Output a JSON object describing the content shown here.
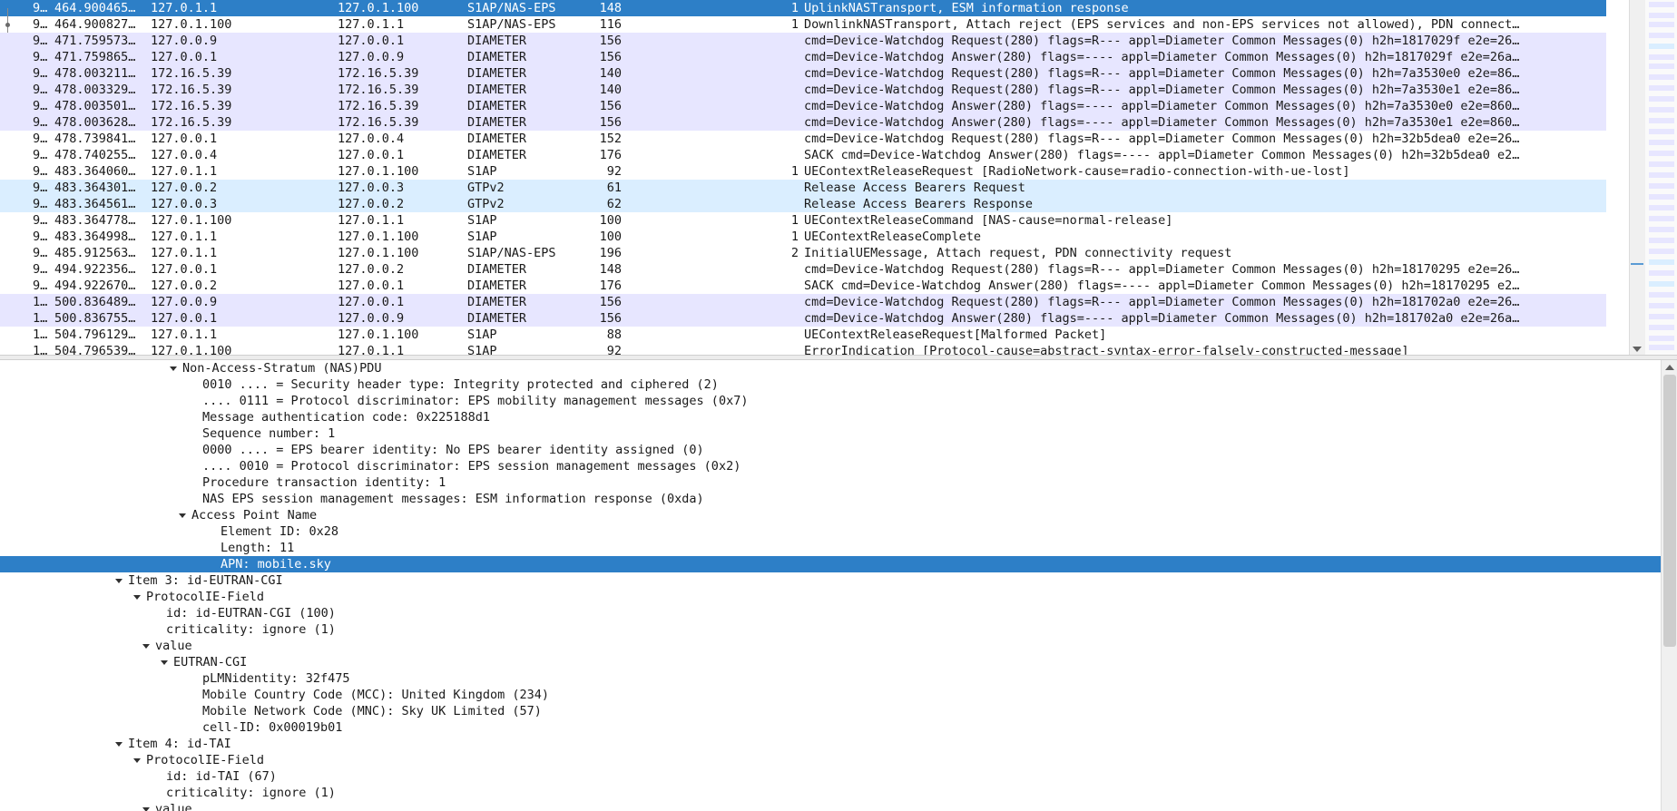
{
  "colors": {
    "selected": "#2d7fc7",
    "diameter_row": "#e7e6ff",
    "gtp_row": "#daeeff",
    "white_row": "#ffffff"
  },
  "packet_list": {
    "rows": [
      {
        "no": "9…",
        "time": "464.900465…",
        "src": "127.0.1.1",
        "dst": "127.0.1.100",
        "proto": "S1AP/NAS-EPS",
        "len": "148",
        "id": "1",
        "info": "UplinkNASTransport, ESM information response",
        "style": "sel"
      },
      {
        "no": "9…",
        "time": "464.900827…",
        "src": "127.0.1.100",
        "dst": "127.0.1.1",
        "proto": "S1AP/NAS-EPS",
        "len": "116",
        "id": "1",
        "info": "DownlinkNASTransport, Attach reject (EPS services and non-EPS services not allowed), PDN connect…",
        "style": "white"
      },
      {
        "no": "9…",
        "time": "471.759573…",
        "src": "127.0.0.9",
        "dst": "127.0.0.1",
        "proto": "DIAMETER",
        "len": "156",
        "id": "",
        "info": "cmd=Device-Watchdog Request(280) flags=R--- appl=Diameter Common Messages(0) h2h=1817029f e2e=26…",
        "style": "diam"
      },
      {
        "no": "9…",
        "time": "471.759865…",
        "src": "127.0.0.1",
        "dst": "127.0.0.9",
        "proto": "DIAMETER",
        "len": "156",
        "id": "",
        "info": "cmd=Device-Watchdog Answer(280) flags=---- appl=Diameter Common Messages(0) h2h=1817029f e2e=26a…",
        "style": "diam"
      },
      {
        "no": "9…",
        "time": "478.003211…",
        "src": "172.16.5.39",
        "dst": "172.16.5.39",
        "proto": "DIAMETER",
        "len": "140",
        "id": "",
        "info": "cmd=Device-Watchdog Request(280) flags=R--- appl=Diameter Common Messages(0) h2h=7a3530e0 e2e=86…",
        "style": "diam"
      },
      {
        "no": "9…",
        "time": "478.003329…",
        "src": "172.16.5.39",
        "dst": "172.16.5.39",
        "proto": "DIAMETER",
        "len": "140",
        "id": "",
        "info": "cmd=Device-Watchdog Request(280) flags=R--- appl=Diameter Common Messages(0) h2h=7a3530e1 e2e=86…",
        "style": "diam"
      },
      {
        "no": "9…",
        "time": "478.003501…",
        "src": "172.16.5.39",
        "dst": "172.16.5.39",
        "proto": "DIAMETER",
        "len": "156",
        "id": "",
        "info": "cmd=Device-Watchdog Answer(280) flags=---- appl=Diameter Common Messages(0) h2h=7a3530e0 e2e=860…",
        "style": "diam"
      },
      {
        "no": "9…",
        "time": "478.003628…",
        "src": "172.16.5.39",
        "dst": "172.16.5.39",
        "proto": "DIAMETER",
        "len": "156",
        "id": "",
        "info": "cmd=Device-Watchdog Answer(280) flags=---- appl=Diameter Common Messages(0) h2h=7a3530e1 e2e=860…",
        "style": "diam"
      },
      {
        "no": "9…",
        "time": "478.739841…",
        "src": "127.0.0.1",
        "dst": "127.0.0.4",
        "proto": "DIAMETER",
        "len": "152",
        "id": "",
        "info": "cmd=Device-Watchdog Request(280) flags=R--- appl=Diameter Common Messages(0) h2h=32b5dea0 e2e=26…",
        "style": "white"
      },
      {
        "no": "9…",
        "time": "478.740255…",
        "src": "127.0.0.4",
        "dst": "127.0.0.1",
        "proto": "DIAMETER",
        "len": "176",
        "id": "",
        "info": "SACK cmd=Device-Watchdog Answer(280) flags=---- appl=Diameter Common Messages(0) h2h=32b5dea0 e2…",
        "style": "white"
      },
      {
        "no": "9…",
        "time": "483.364060…",
        "src": "127.0.1.1",
        "dst": "127.0.1.100",
        "proto": "S1AP",
        "len": "92",
        "id": "1",
        "info": "UEContextReleaseRequest [RadioNetwork-cause=radio-connection-with-ue-lost]",
        "style": "white"
      },
      {
        "no": "9…",
        "time": "483.364301…",
        "src": "127.0.0.2",
        "dst": "127.0.0.3",
        "proto": "GTPv2",
        "len": "61",
        "id": "",
        "info": "Release Access Bearers Request",
        "style": "gtp"
      },
      {
        "no": "9…",
        "time": "483.364561…",
        "src": "127.0.0.3",
        "dst": "127.0.0.2",
        "proto": "GTPv2",
        "len": "62",
        "id": "",
        "info": "Release Access Bearers Response",
        "style": "gtp"
      },
      {
        "no": "9…",
        "time": "483.364778…",
        "src": "127.0.1.100",
        "dst": "127.0.1.1",
        "proto": "S1AP",
        "len": "100",
        "id": "1",
        "info": "UEContextReleaseCommand [NAS-cause=normal-release]",
        "style": "white"
      },
      {
        "no": "9…",
        "time": "483.364998…",
        "src": "127.0.1.1",
        "dst": "127.0.1.100",
        "proto": "S1AP",
        "len": "100",
        "id": "1",
        "info": "UEContextReleaseComplete",
        "style": "white"
      },
      {
        "no": "9…",
        "time": "485.912563…",
        "src": "127.0.1.1",
        "dst": "127.0.1.100",
        "proto": "S1AP/NAS-EPS",
        "len": "196",
        "id": "2",
        "info": "InitialUEMessage, Attach request, PDN connectivity request",
        "style": "white"
      },
      {
        "no": "9…",
        "time": "494.922356…",
        "src": "127.0.0.1",
        "dst": "127.0.0.2",
        "proto": "DIAMETER",
        "len": "148",
        "id": "",
        "info": "cmd=Device-Watchdog Request(280) flags=R--- appl=Diameter Common Messages(0) h2h=18170295 e2e=26…",
        "style": "white"
      },
      {
        "no": "9…",
        "time": "494.922670…",
        "src": "127.0.0.2",
        "dst": "127.0.0.1",
        "proto": "DIAMETER",
        "len": "176",
        "id": "",
        "info": "SACK cmd=Device-Watchdog Answer(280) flags=---- appl=Diameter Common Messages(0) h2h=18170295 e2…",
        "style": "white"
      },
      {
        "no": "1…",
        "time": "500.836489…",
        "src": "127.0.0.9",
        "dst": "127.0.0.1",
        "proto": "DIAMETER",
        "len": "156",
        "id": "",
        "info": "cmd=Device-Watchdog Request(280) flags=R--- appl=Diameter Common Messages(0) h2h=181702a0 e2e=26…",
        "style": "diam"
      },
      {
        "no": "1…",
        "time": "500.836755…",
        "src": "127.0.0.1",
        "dst": "127.0.0.9",
        "proto": "DIAMETER",
        "len": "156",
        "id": "",
        "info": "cmd=Device-Watchdog Answer(280) flags=---- appl=Diameter Common Messages(0) h2h=181702a0 e2e=26a…",
        "style": "diam"
      },
      {
        "no": "1…",
        "time": "504.796129…",
        "src": "127.0.1.1",
        "dst": "127.0.1.100",
        "proto": "S1AP",
        "len": "88",
        "id": "",
        "info": "UEContextReleaseRequest[Malformed Packet]",
        "style": "white"
      },
      {
        "no": "1…",
        "time": "504.796539…",
        "src": "127.0.1.100",
        "dst": "127.0.1.1",
        "proto": "S1AP",
        "len": "92",
        "id": "",
        "info": "ErrorIndication [Protocol-cause=abstract-syntax-error-falsely-constructed-message]",
        "style": "white"
      }
    ]
  },
  "packet_details": {
    "rows": [
      {
        "text": "Non-Access-Stratum (NAS)PDU",
        "level": 0,
        "expanded": true
      },
      {
        "text": "0010 .... = Security header type: Integrity protected and ciphered (2)",
        "level": 1
      },
      {
        "text": ".... 0111 = Protocol discriminator: EPS mobility management messages (0x7)",
        "level": 1
      },
      {
        "text": "Message authentication code: 0x225188d1",
        "level": 1
      },
      {
        "text": "Sequence number: 1",
        "level": 1
      },
      {
        "text": "0000 .... = EPS bearer identity: No EPS bearer identity assigned (0)",
        "level": 1
      },
      {
        "text": ".... 0010 = Protocol discriminator: EPS session management messages (0x2)",
        "level": 1
      },
      {
        "text": "Procedure transaction identity: 1",
        "level": 1
      },
      {
        "text": "NAS EPS session management messages: ESM information response (0xda)",
        "level": 1
      },
      {
        "text": "Access Point Name",
        "level": 0.5,
        "expanded": true
      },
      {
        "text": "Element ID: 0x28",
        "level": 2
      },
      {
        "text": "Length: 11",
        "level": 2
      },
      {
        "text": "APN: mobile.sky",
        "level": 2,
        "selected": true
      },
      {
        "text": "Item 3: id-EUTRAN-CGI",
        "level": -3,
        "expanded": true
      },
      {
        "text": "ProtocolIE-Field",
        "level": -2,
        "expanded": true
      },
      {
        "text": "id: id-EUTRAN-CGI (100)",
        "level": -1
      },
      {
        "text": "criticality: ignore (1)",
        "level": -1
      },
      {
        "text": "value",
        "level": -1.5,
        "expanded": true
      },
      {
        "text": "EUTRAN-CGI",
        "level": -0.5,
        "expanded": true
      },
      {
        "text": "pLMNidentity: 32f475",
        "level": 1
      },
      {
        "text": "Mobile Country Code (MCC): United Kingdom (234)",
        "level": 1
      },
      {
        "text": "Mobile Network Code (MNC): Sky UK Limited (57)",
        "level": 1
      },
      {
        "text": "cell-ID: 0x00019b01",
        "level": 1
      },
      {
        "text": "Item 4: id-TAI",
        "level": -3,
        "expanded": true
      },
      {
        "text": "ProtocolIE-Field",
        "level": -2,
        "expanded": true
      },
      {
        "text": "id: id-TAI (67)",
        "level": -1
      },
      {
        "text": "criticality: ignore (1)",
        "level": -1
      },
      {
        "text": "value",
        "level": -1.5,
        "expanded": true
      }
    ]
  }
}
